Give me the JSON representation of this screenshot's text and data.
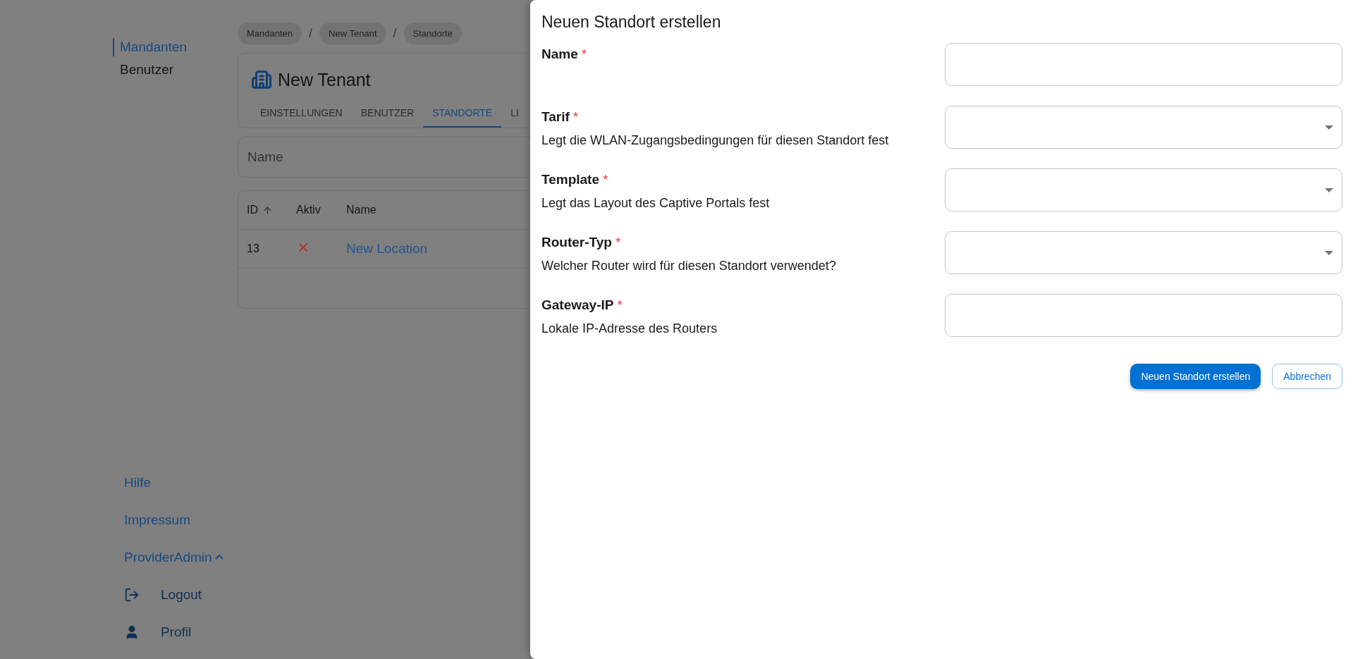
{
  "sidebar": {
    "items": [
      {
        "label": "Mandanten",
        "selected": true
      },
      {
        "label": "Benutzer",
        "selected": false
      }
    ],
    "footer_links": [
      {
        "label": "Hilfe"
      },
      {
        "label": "Impressum"
      }
    ],
    "user_menu": {
      "label": "ProviderAdmin",
      "expanded": true,
      "items": [
        {
          "label": "Logout",
          "kind": "logout"
        },
        {
          "label": "Profil",
          "kind": "profile"
        }
      ]
    }
  },
  "breadcrumbs": {
    "separator": "/",
    "items": [
      "Mandanten",
      "New Tenant",
      "Standorte"
    ]
  },
  "tenant": {
    "title": "New Tenant",
    "tabs": [
      {
        "label": "EINSTELLUNGEN",
        "selected": false
      },
      {
        "label": "BENUTZER",
        "selected": false
      },
      {
        "label": "STANDORTE",
        "selected": true
      },
      {
        "label": "LI",
        "selected": false
      }
    ]
  },
  "filter": {
    "placeholder": "Name"
  },
  "table": {
    "columns": [
      {
        "label": "ID",
        "sorted": true
      },
      {
        "label": "Aktiv",
        "sorted": false
      },
      {
        "label": "Name",
        "sorted": false
      }
    ],
    "rows": [
      {
        "id": "13",
        "active": false,
        "name": "New Location"
      }
    ]
  },
  "dialog": {
    "title": "Neuen Standort erstellen",
    "fields": [
      {
        "label": "Name",
        "required_mark": "*",
        "kind": "text"
      },
      {
        "label": "Tarif",
        "required_mark": "*",
        "help": "Legt die WLAN-Zugangsbedingungen für diesen Standort fest",
        "kind": "select"
      },
      {
        "label": "Template",
        "required_mark": "*",
        "help": "Legt das Layout des Captive Portals fest",
        "kind": "select"
      },
      {
        "label": "Router-Typ",
        "required_mark": "*",
        "help": "Welcher Router wird für diesen Standort verwendet?",
        "kind": "select"
      },
      {
        "label": "Gateway-IP",
        "required_mark": "*",
        "help": "Lokale IP-Adresse des Routers",
        "kind": "text"
      }
    ],
    "buttons": [
      {
        "label": "Neuen Standort erstellen",
        "kind": "primary"
      },
      {
        "label": "Abbrechen",
        "kind": "secondary"
      }
    ]
  }
}
